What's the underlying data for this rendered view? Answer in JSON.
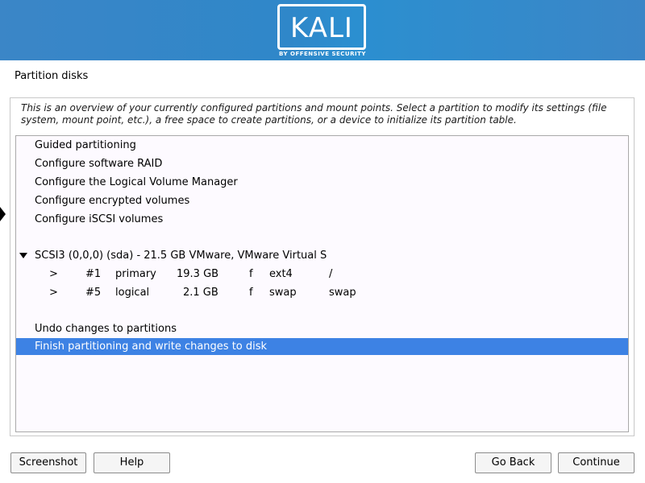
{
  "banner": {
    "logo_text": "KALI",
    "logo_subtitle": "BY OFFENSIVE SECURITY",
    "color": "#2f87c9"
  },
  "page": {
    "title": "Partition disks",
    "description": "This is an overview of your currently configured partitions and mount points. Select a partition to modify its settings (file system, mount point, etc.), a free space to create partitions, or a device to initialize its partition table."
  },
  "menu": {
    "guided": "Guided partitioning",
    "raid": "Configure software RAID",
    "lvm": "Configure the Logical Volume Manager",
    "encrypted": "Configure encrypted volumes",
    "iscsi": "Configure iSCSI volumes",
    "undo": "Undo changes to partitions",
    "finish": "Finish partitioning and write changes to disk"
  },
  "disk": {
    "label": "SCSI3 (0,0,0) (sda) - 21.5 GB VMware, VMware Virtual S",
    "partitions": [
      {
        "marker": ">",
        "number": "#1",
        "type": "primary",
        "size": "19.3 GB",
        "flag": "f",
        "fs": "ext4",
        "mount": "/"
      },
      {
        "marker": ">",
        "number": "#5",
        "type": "logical",
        "size": "2.1 GB",
        "flag": "f",
        "fs": "swap",
        "mount": "swap"
      }
    ]
  },
  "buttons": {
    "screenshot": "Screenshot",
    "help": "Help",
    "go_back": "Go Back",
    "continue": "Continue"
  },
  "colors": {
    "selection": "#3d82e4"
  }
}
